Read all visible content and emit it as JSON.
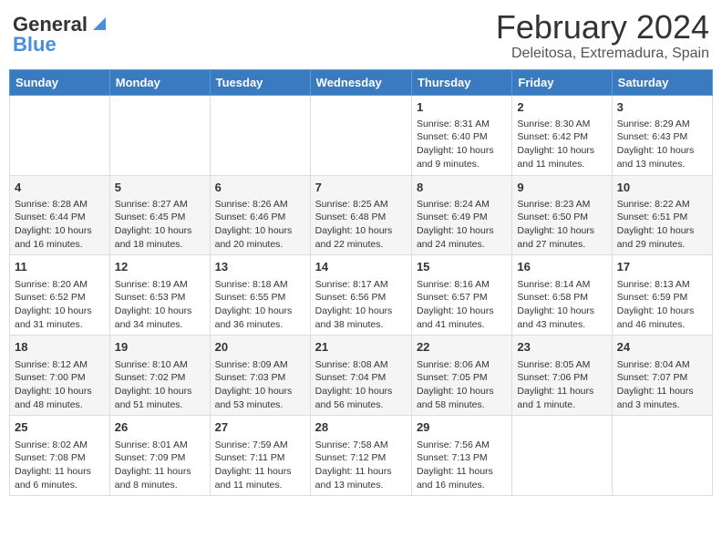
{
  "header": {
    "logo_general": "General",
    "logo_blue": "Blue",
    "month_title": "February 2024",
    "location": "Deleitosa, Extremadura, Spain"
  },
  "days_of_week": [
    "Sunday",
    "Monday",
    "Tuesday",
    "Wednesday",
    "Thursday",
    "Friday",
    "Saturday"
  ],
  "weeks": [
    [
      {
        "day": "",
        "content": ""
      },
      {
        "day": "",
        "content": ""
      },
      {
        "day": "",
        "content": ""
      },
      {
        "day": "",
        "content": ""
      },
      {
        "day": "1",
        "content": "Sunrise: 8:31 AM\nSunset: 6:40 PM\nDaylight: 10 hours and 9 minutes."
      },
      {
        "day": "2",
        "content": "Sunrise: 8:30 AM\nSunset: 6:42 PM\nDaylight: 10 hours and 11 minutes."
      },
      {
        "day": "3",
        "content": "Sunrise: 8:29 AM\nSunset: 6:43 PM\nDaylight: 10 hours and 13 minutes."
      }
    ],
    [
      {
        "day": "4",
        "content": "Sunrise: 8:28 AM\nSunset: 6:44 PM\nDaylight: 10 hours and 16 minutes."
      },
      {
        "day": "5",
        "content": "Sunrise: 8:27 AM\nSunset: 6:45 PM\nDaylight: 10 hours and 18 minutes."
      },
      {
        "day": "6",
        "content": "Sunrise: 8:26 AM\nSunset: 6:46 PM\nDaylight: 10 hours and 20 minutes."
      },
      {
        "day": "7",
        "content": "Sunrise: 8:25 AM\nSunset: 6:48 PM\nDaylight: 10 hours and 22 minutes."
      },
      {
        "day": "8",
        "content": "Sunrise: 8:24 AM\nSunset: 6:49 PM\nDaylight: 10 hours and 24 minutes."
      },
      {
        "day": "9",
        "content": "Sunrise: 8:23 AM\nSunset: 6:50 PM\nDaylight: 10 hours and 27 minutes."
      },
      {
        "day": "10",
        "content": "Sunrise: 8:22 AM\nSunset: 6:51 PM\nDaylight: 10 hours and 29 minutes."
      }
    ],
    [
      {
        "day": "11",
        "content": "Sunrise: 8:20 AM\nSunset: 6:52 PM\nDaylight: 10 hours and 31 minutes."
      },
      {
        "day": "12",
        "content": "Sunrise: 8:19 AM\nSunset: 6:53 PM\nDaylight: 10 hours and 34 minutes."
      },
      {
        "day": "13",
        "content": "Sunrise: 8:18 AM\nSunset: 6:55 PM\nDaylight: 10 hours and 36 minutes."
      },
      {
        "day": "14",
        "content": "Sunrise: 8:17 AM\nSunset: 6:56 PM\nDaylight: 10 hours and 38 minutes."
      },
      {
        "day": "15",
        "content": "Sunrise: 8:16 AM\nSunset: 6:57 PM\nDaylight: 10 hours and 41 minutes."
      },
      {
        "day": "16",
        "content": "Sunrise: 8:14 AM\nSunset: 6:58 PM\nDaylight: 10 hours and 43 minutes."
      },
      {
        "day": "17",
        "content": "Sunrise: 8:13 AM\nSunset: 6:59 PM\nDaylight: 10 hours and 46 minutes."
      }
    ],
    [
      {
        "day": "18",
        "content": "Sunrise: 8:12 AM\nSunset: 7:00 PM\nDaylight: 10 hours and 48 minutes."
      },
      {
        "day": "19",
        "content": "Sunrise: 8:10 AM\nSunset: 7:02 PM\nDaylight: 10 hours and 51 minutes."
      },
      {
        "day": "20",
        "content": "Sunrise: 8:09 AM\nSunset: 7:03 PM\nDaylight: 10 hours and 53 minutes."
      },
      {
        "day": "21",
        "content": "Sunrise: 8:08 AM\nSunset: 7:04 PM\nDaylight: 10 hours and 56 minutes."
      },
      {
        "day": "22",
        "content": "Sunrise: 8:06 AM\nSunset: 7:05 PM\nDaylight: 10 hours and 58 minutes."
      },
      {
        "day": "23",
        "content": "Sunrise: 8:05 AM\nSunset: 7:06 PM\nDaylight: 11 hours and 1 minute."
      },
      {
        "day": "24",
        "content": "Sunrise: 8:04 AM\nSunset: 7:07 PM\nDaylight: 11 hours and 3 minutes."
      }
    ],
    [
      {
        "day": "25",
        "content": "Sunrise: 8:02 AM\nSunset: 7:08 PM\nDaylight: 11 hours and 6 minutes."
      },
      {
        "day": "26",
        "content": "Sunrise: 8:01 AM\nSunset: 7:09 PM\nDaylight: 11 hours and 8 minutes."
      },
      {
        "day": "27",
        "content": "Sunrise: 7:59 AM\nSunset: 7:11 PM\nDaylight: 11 hours and 11 minutes."
      },
      {
        "day": "28",
        "content": "Sunrise: 7:58 AM\nSunset: 7:12 PM\nDaylight: 11 hours and 13 minutes."
      },
      {
        "day": "29",
        "content": "Sunrise: 7:56 AM\nSunset: 7:13 PM\nDaylight: 11 hours and 16 minutes."
      },
      {
        "day": "",
        "content": ""
      },
      {
        "day": "",
        "content": ""
      }
    ]
  ]
}
